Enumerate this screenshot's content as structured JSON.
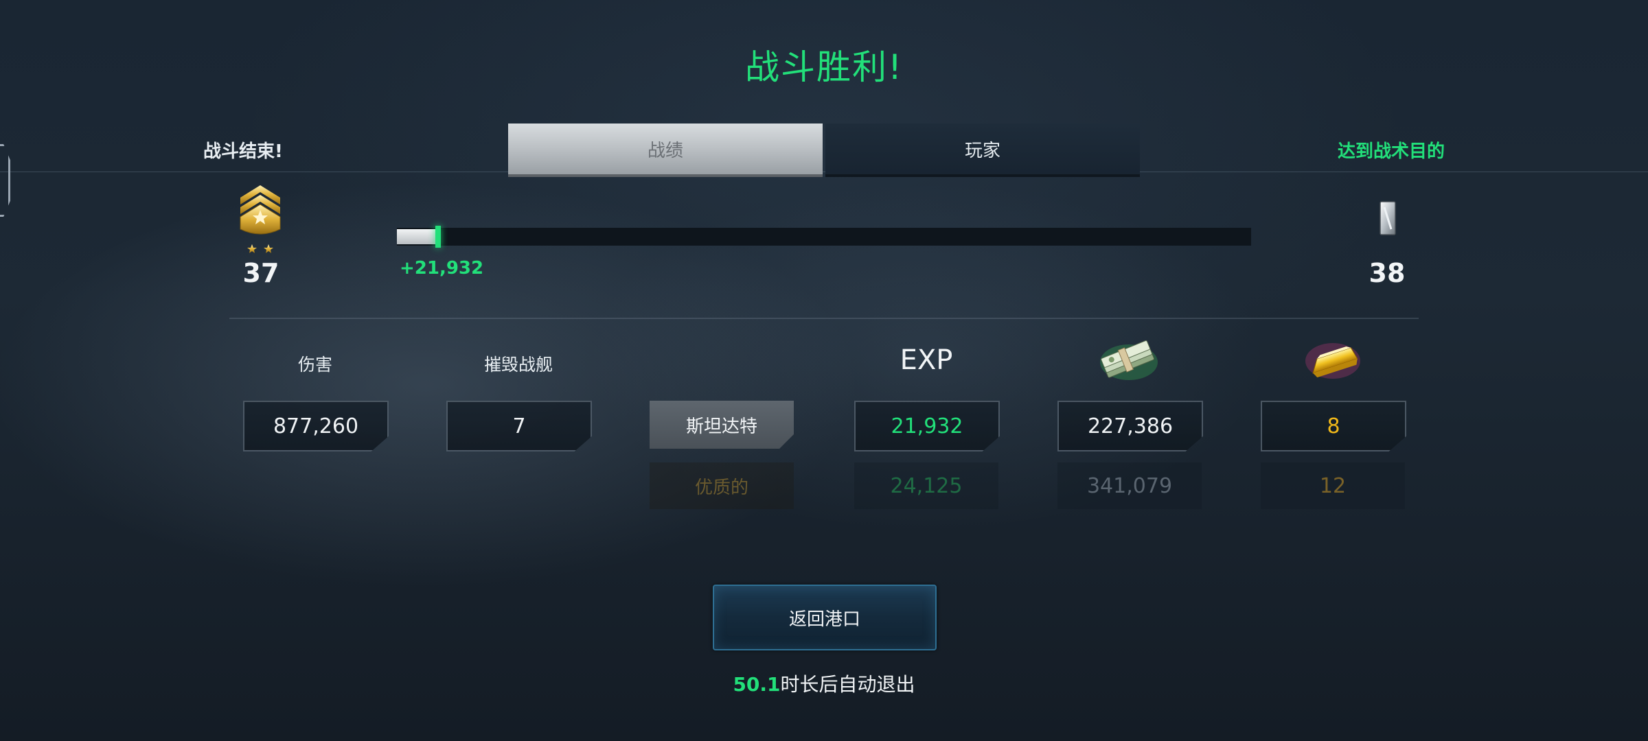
{
  "title": "战斗胜利!",
  "header": {
    "battle_over": "战斗结束!",
    "objective": "达到战术目的"
  },
  "tabs": [
    {
      "label": "战绩",
      "active": true
    },
    {
      "label": "玩家",
      "active": false
    }
  ],
  "rank": {
    "current": "37",
    "next": "38",
    "progress_fraction": 0.047,
    "gain": "+21,932"
  },
  "stats": {
    "damage_label": "伤害",
    "damage_value": "877,260",
    "kills_label": "摧毁战舰",
    "kills_value": "7",
    "exp_label": "EXP",
    "cash_icon": "cash-stack-icon",
    "gold_icon": "gold-bar-icon"
  },
  "tiers": {
    "standard": {
      "label": "斯坦达特",
      "exp": "21,932",
      "cash": "227,386",
      "gold": "8"
    },
    "premium": {
      "label": "优质的",
      "exp": "24,125",
      "cash": "341,079",
      "gold": "12"
    }
  },
  "actions": {
    "return_label": "返回港口"
  },
  "auto_exit": {
    "seconds": "50.1",
    "text": "时长后自动退出"
  },
  "colors": {
    "accent_green": "#22e07a",
    "gold": "#f0b81a",
    "premium_exp": "#1f6b44",
    "premium_gold": "#7a6228",
    "premium_cash": "#5a6570"
  }
}
